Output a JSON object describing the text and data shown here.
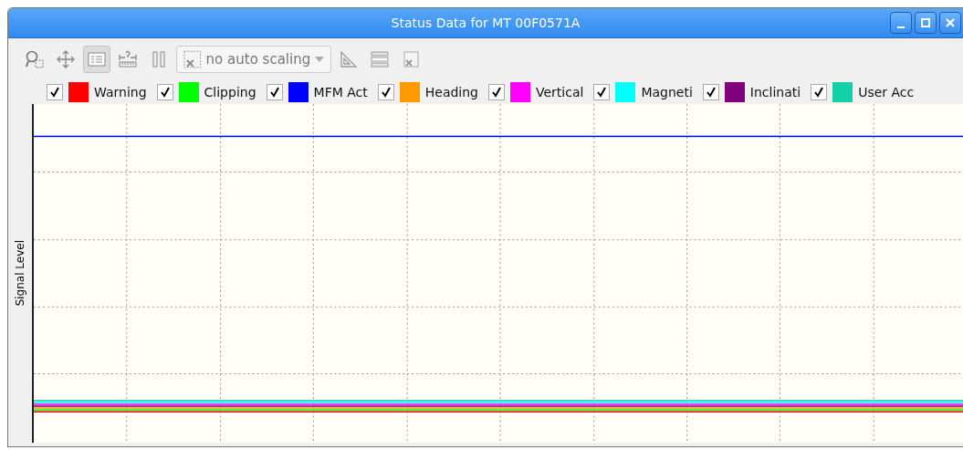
{
  "window": {
    "title": "Status Data for MT 00F0571A"
  },
  "toolbar": {
    "tools": [
      {
        "kind": "zoom",
        "pressed": false
      },
      {
        "kind": "pan",
        "pressed": false
      },
      {
        "kind": "legend",
        "pressed": true
      },
      {
        "kind": "fit",
        "pressed": false
      },
      {
        "kind": "pause",
        "pressed": false
      }
    ],
    "scaling": {
      "value": "no auto scaling",
      "disabled": true
    },
    "tools_after": [
      {
        "kind": "ruler",
        "disabled": true
      },
      {
        "kind": "span",
        "disabled": true
      },
      {
        "kind": "reset",
        "disabled": true
      }
    ]
  },
  "legend": [
    {
      "label": "Warning",
      "checked": true,
      "color": "#ff0000"
    },
    {
      "label": "Clipping",
      "checked": true,
      "color": "#00ff00"
    },
    {
      "label": "MFM Act",
      "checked": true,
      "color": "#0000ff"
    },
    {
      "label": "Heading",
      "checked": true,
      "color": "#ff9900"
    },
    {
      "label": "Vertical",
      "checked": true,
      "color": "#ff00ff"
    },
    {
      "label": "Magneti",
      "checked": true,
      "color": "#00ffff"
    },
    {
      "label": "Inclinati",
      "checked": true,
      "color": "#800080"
    },
    {
      "label": "User Acc",
      "checked": true,
      "color": "#14d0a8"
    }
  ],
  "plot": {
    "ylabel": "Signal Level"
  }
}
